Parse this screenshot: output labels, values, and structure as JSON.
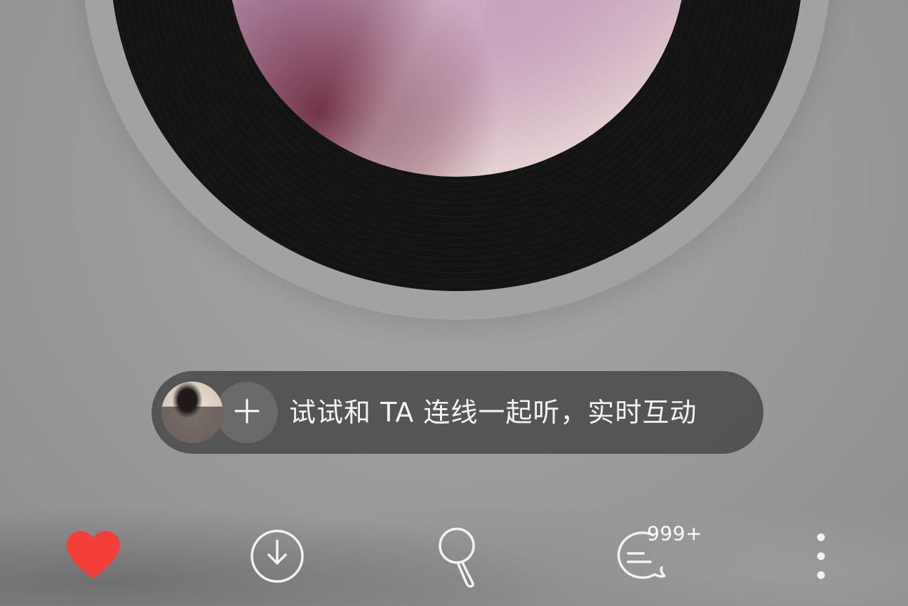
{
  "player": {
    "listen_together": {
      "prompt": "试试和 TA 连线一起听，实时互动"
    },
    "actions": {
      "like_color": "#F33E3A",
      "comment_count": "999+"
    },
    "icons": [
      "heart-icon",
      "download-icon",
      "karaoke-mic-icon",
      "comment-icon",
      "more-vertical-icon",
      "plus-icon"
    ]
  }
}
